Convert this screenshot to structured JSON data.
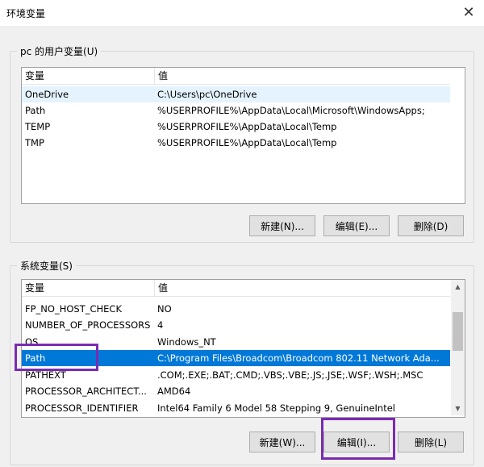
{
  "window": {
    "title": "环境变量",
    "close_glyph": "✕"
  },
  "user_vars": {
    "group_label": "pc 的用户变量(U)",
    "columns": [
      "变量",
      "值"
    ],
    "rows": [
      {
        "name": "OneDrive",
        "value": "C:\\Users\\pc\\OneDrive"
      },
      {
        "name": "Path",
        "value": "%USERPROFILE%\\AppData\\Local\\Microsoft\\WindowsApps;"
      },
      {
        "name": "TEMP",
        "value": "%USERPROFILE%\\AppData\\Local\\Temp"
      },
      {
        "name": "TMP",
        "value": "%USERPROFILE%\\AppData\\Local\\Temp"
      }
    ],
    "buttons": {
      "new": "新建(N)...",
      "edit": "编辑(E)...",
      "delete": "删除(D)"
    }
  },
  "system_vars": {
    "group_label": "系统变量(S)",
    "columns": [
      "变量",
      "值"
    ],
    "rows": [
      {
        "name": "FP_NO_HOST_CHECK",
        "value": "NO"
      },
      {
        "name": "NUMBER_OF_PROCESSORS",
        "value": "4"
      },
      {
        "name": "OS",
        "value": "Windows_NT"
      },
      {
        "name": "Path",
        "value": "C:\\Program Files\\Broadcom\\Broadcom 802.11 Network Ada..."
      },
      {
        "name": "PATHEXT",
        "value": ".COM;.EXE;.BAT;.CMD;.VBS;.VBE;.JS;.JSE;.WSF;.WSH;.MSC"
      },
      {
        "name": "PROCESSOR_ARCHITECT...",
        "value": "AMD64"
      },
      {
        "name": "PROCESSOR_IDENTIFIER",
        "value": "Intel64 Family 6 Model 58 Stepping 9, GenuineIntel"
      }
    ],
    "selected_row": "Path",
    "buttons": {
      "new": "新建(W)...",
      "edit": "编辑(I)...",
      "delete": "删除(L)"
    }
  },
  "colors": {
    "selection": "#0078d7",
    "highlight_box": "#7b2bb3",
    "hover": "#e5f3ff"
  }
}
